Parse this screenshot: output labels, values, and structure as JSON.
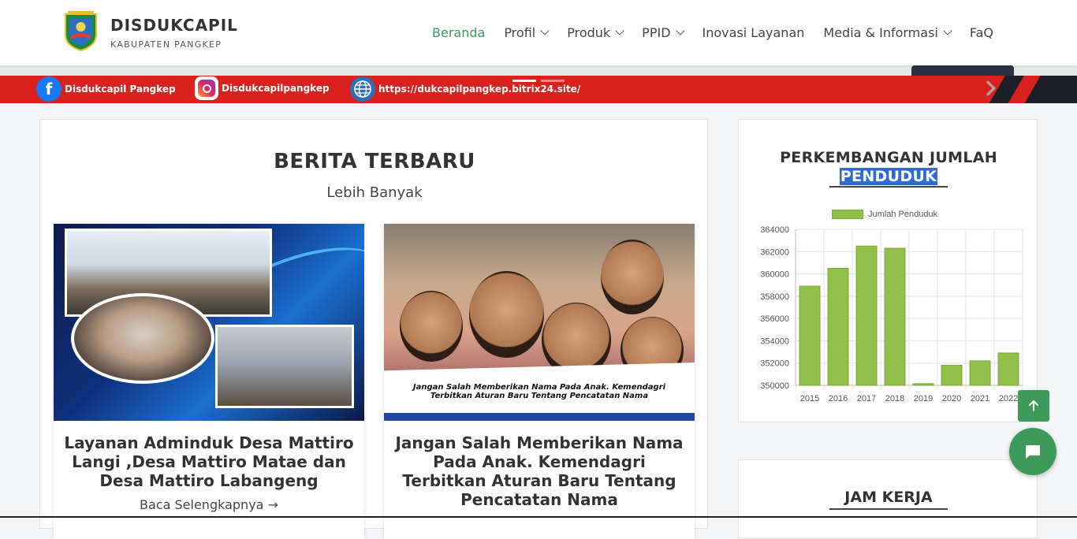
{
  "header": {
    "brand_title": "DISDUKCAPIL",
    "brand_sub": "KABUPATEN PANGKEP",
    "nav": [
      {
        "label": "Beranda",
        "has_dropdown": false,
        "active": true
      },
      {
        "label": "Profil",
        "has_dropdown": true,
        "active": false
      },
      {
        "label": "Produk",
        "has_dropdown": true,
        "active": false
      },
      {
        "label": "PPID",
        "has_dropdown": true,
        "active": false
      },
      {
        "label": "Inovasi Layanan",
        "has_dropdown": false,
        "active": false
      },
      {
        "label": "Media & Informasi",
        "has_dropdown": true,
        "active": false
      },
      {
        "label": "FaQ",
        "has_dropdown": false,
        "active": false
      }
    ]
  },
  "hero": {
    "facebook": "Disdukcapil Pangkep",
    "instagram": "Disdukcapilpangkep",
    "website": "https://dukcapilpangkep.bitrix24.site/",
    "facebook_icon": "f"
  },
  "news": {
    "title": "BERITA TERBARU",
    "more": "Lebih Banyak",
    "articles": [
      {
        "title": "Layanan Adminduk Desa Mattiro Langi ,Desa Mattiro Matae dan Desa Mattiro Labangeng",
        "read_more": "Baca Selengkapnya →"
      },
      {
        "title": "Jangan Salah Memberikan Nama Pada Anak. Kemendagri Terbitkan Aturan Baru Tentang Pencatatan Nama",
        "banner_text": "Jangan Salah Memberikan Nama Pada Anak. Kemendagri Terbitkan Aturan Baru Tentang Pencatatan Nama"
      }
    ]
  },
  "sidebar": {
    "chart_title_1": "PERKEMBANGAN JUMLAH",
    "chart_title_2": "PENDUDUK",
    "jam_kerja": "JAM KERJA"
  },
  "colors": {
    "accent": "#3d9a5b",
    "banner_red": "#d9221d",
    "bar_fill": "#92c04a",
    "highlight": "#2e6bd4"
  },
  "chart_data": {
    "type": "bar",
    "title": "PERKEMBANGAN JUMLAH PENDUDUK",
    "categories": [
      "2015",
      "2016",
      "2017",
      "2018",
      "2019",
      "2020",
      "2021",
      "2022"
    ],
    "series": [
      {
        "name": "Jumlah Penduduk",
        "values": [
          358900,
          360500,
          362500,
          362300,
          350150,
          351800,
          352200,
          352900
        ]
      }
    ],
    "ylim": [
      350000,
      364000
    ],
    "yticks": [
      "364000",
      "362000",
      "360000",
      "358000",
      "356000",
      "354000",
      "352000",
      "350000"
    ],
    "grid": true,
    "legend": "top"
  }
}
